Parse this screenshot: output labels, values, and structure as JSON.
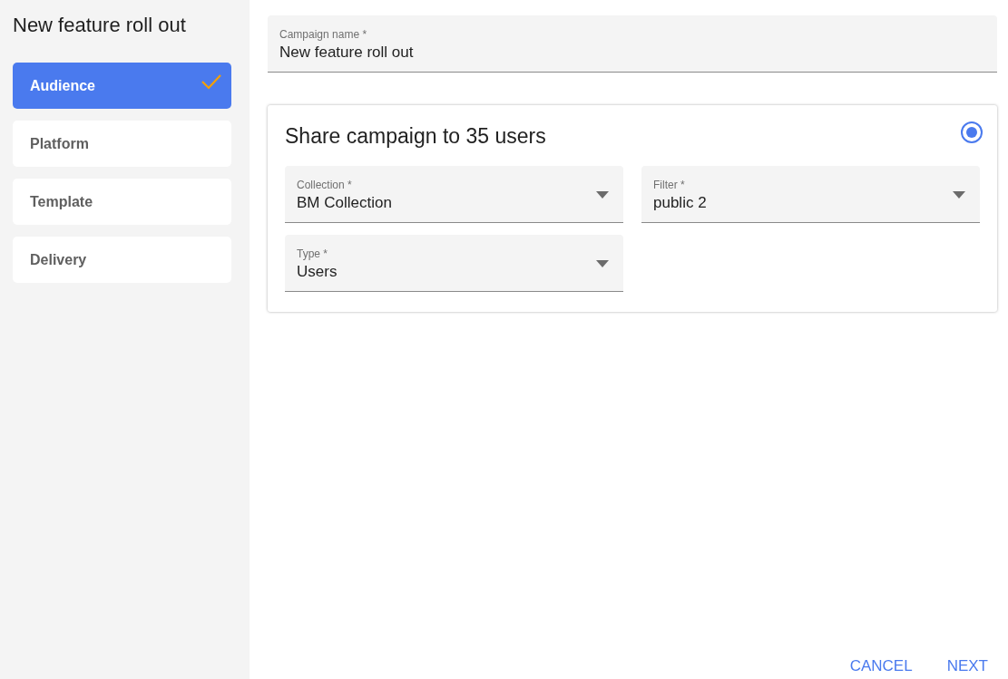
{
  "title": "New feature roll out",
  "steps": [
    {
      "label": "Audience",
      "selected": true,
      "completed": true
    },
    {
      "label": "Platform",
      "selected": false,
      "completed": false
    },
    {
      "label": "Template",
      "selected": false,
      "completed": false
    },
    {
      "label": "Delivery",
      "selected": false,
      "completed": false
    }
  ],
  "campaign_name": {
    "label": "Campaign name *",
    "value": "New feature roll out"
  },
  "audience_card": {
    "title": "Share campaign to 35 users",
    "selected": true,
    "selects": [
      {
        "label": "Collection *",
        "value": "BM Collection"
      },
      {
        "label": "Filter *",
        "value": "public 2"
      },
      {
        "label": "Type *",
        "value": "Users"
      }
    ]
  },
  "buttons": [
    "CANCEL",
    "NEXT"
  ]
}
